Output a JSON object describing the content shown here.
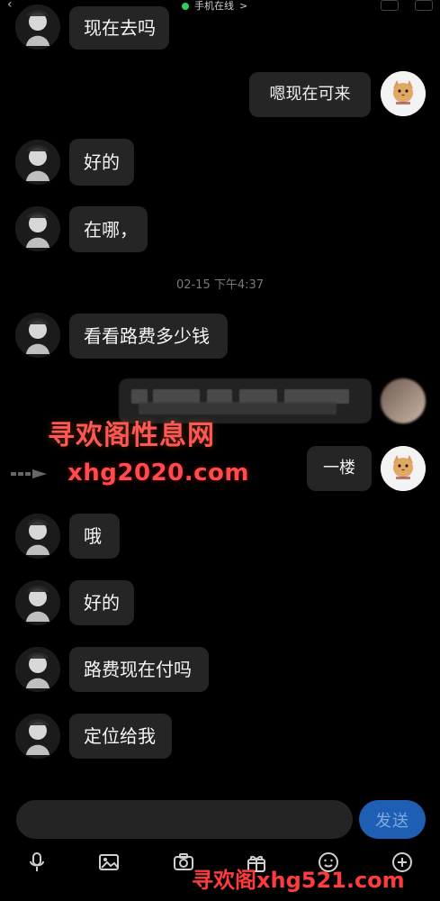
{
  "header": {
    "status_text": "手机在线",
    "status_chevron": ">",
    "status_color": "#2bd35a"
  },
  "messages": [
    {
      "side": "left",
      "text": "现在去吗"
    },
    {
      "side": "right",
      "text": "嗯现在可来"
    },
    {
      "side": "left",
      "text": "好的"
    },
    {
      "side": "left",
      "text": "在哪，"
    },
    {
      "type": "timestamp",
      "text": "02-15 下午4:37"
    },
    {
      "side": "left",
      "text": "看看路费多少钱"
    },
    {
      "side": "right",
      "text": "",
      "blurred": true
    },
    {
      "side": "right",
      "text": "一楼"
    },
    {
      "side": "left",
      "text": "哦"
    },
    {
      "side": "left",
      "text": "好的"
    },
    {
      "side": "left",
      "text": "路费现在付吗"
    },
    {
      "side": "left",
      "text": "定位给我"
    }
  ],
  "watermark": {
    "title": "寻欢阁性息网",
    "url": "xhg2020.com",
    "bottom": "寻欢阁xhg521.com"
  },
  "composer": {
    "input_value": "",
    "send_label": "发送"
  },
  "toolbar": {
    "icons": [
      "mic-icon",
      "image-icon",
      "camera-icon",
      "gift-icon",
      "emoji-icon",
      "plus-icon"
    ]
  },
  "colors": {
    "background": "#000000",
    "bubble": "#252525",
    "send_button": "#1e5fb4",
    "watermark": "#ff4b4b"
  }
}
